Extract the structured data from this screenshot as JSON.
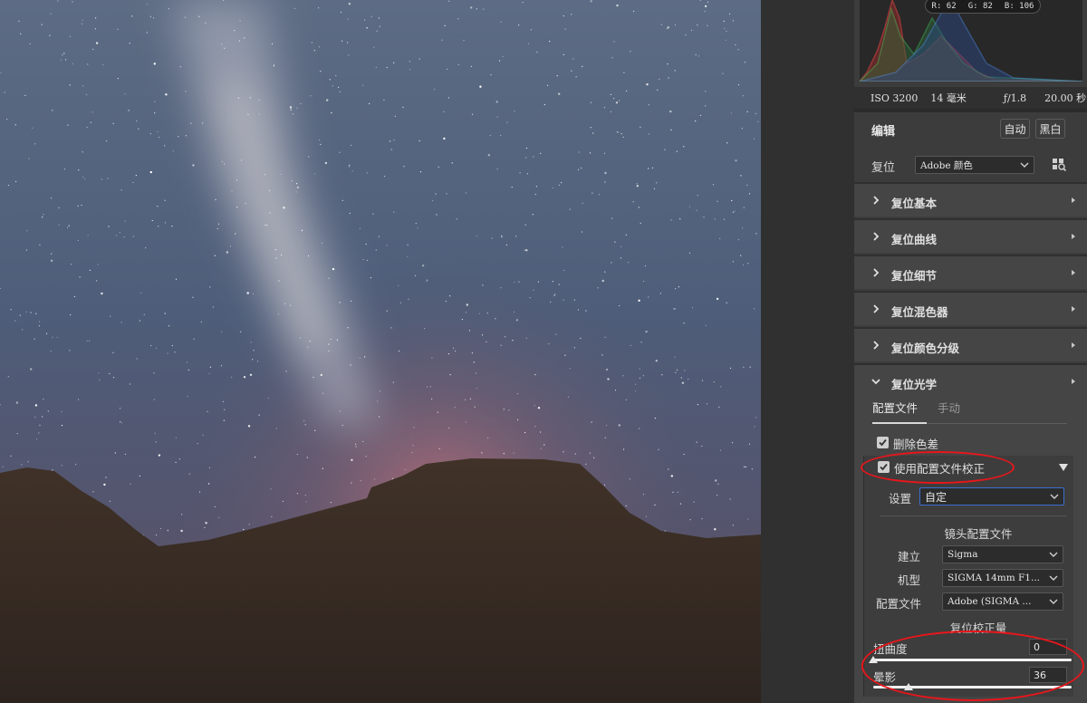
{
  "histogram": {
    "readout": {
      "r": "R: 62",
      "g": "G: 82",
      "b": "B: 106"
    }
  },
  "exif": {
    "iso": "ISO 3200",
    "focal": "14 毫米",
    "aperture": "ƒ/1.8",
    "shutter": "20.00 秒"
  },
  "edit": {
    "title": "编辑",
    "auto_label": "自动",
    "bw_label": "黑白"
  },
  "profile": {
    "label": "复位",
    "value": "Adobe 颜色"
  },
  "sections": [
    {
      "label": "复位基本",
      "expanded": false
    },
    {
      "label": "复位曲线",
      "expanded": false
    },
    {
      "label": "复位细节",
      "expanded": false
    },
    {
      "label": "复位混色器",
      "expanded": false
    },
    {
      "label": "复位颜色分级",
      "expanded": false
    },
    {
      "label": "复位光学",
      "expanded": true
    }
  ],
  "optics": {
    "tabs": [
      {
        "label": "配置文件",
        "active": true
      },
      {
        "label": "手动",
        "active": false
      }
    ],
    "remove_ca": {
      "label": "删除色差",
      "checked": true
    },
    "use_profile": {
      "label": "使用配置文件校正",
      "checked": true
    },
    "setup": {
      "label": "设置",
      "value": "自定"
    },
    "lens_profile_title": "镜头配置文件",
    "make": {
      "label": "建立",
      "value": "Sigma"
    },
    "model": {
      "label": "机型",
      "value": "SIGMA 14mm F1..."
    },
    "profile_file": {
      "label": "配置文件",
      "value": "Adobe (SIGMA ..."
    },
    "amount_title": "复位校正量",
    "distortion": {
      "label": "扭曲度",
      "value": "0",
      "level": 0
    },
    "vignetting": {
      "label": "晕影",
      "value": "36",
      "level": 0.18
    }
  },
  "colors": {
    "annotation": "#e8161b",
    "panel": "#454545",
    "accent_select": "#3b6fd0"
  }
}
